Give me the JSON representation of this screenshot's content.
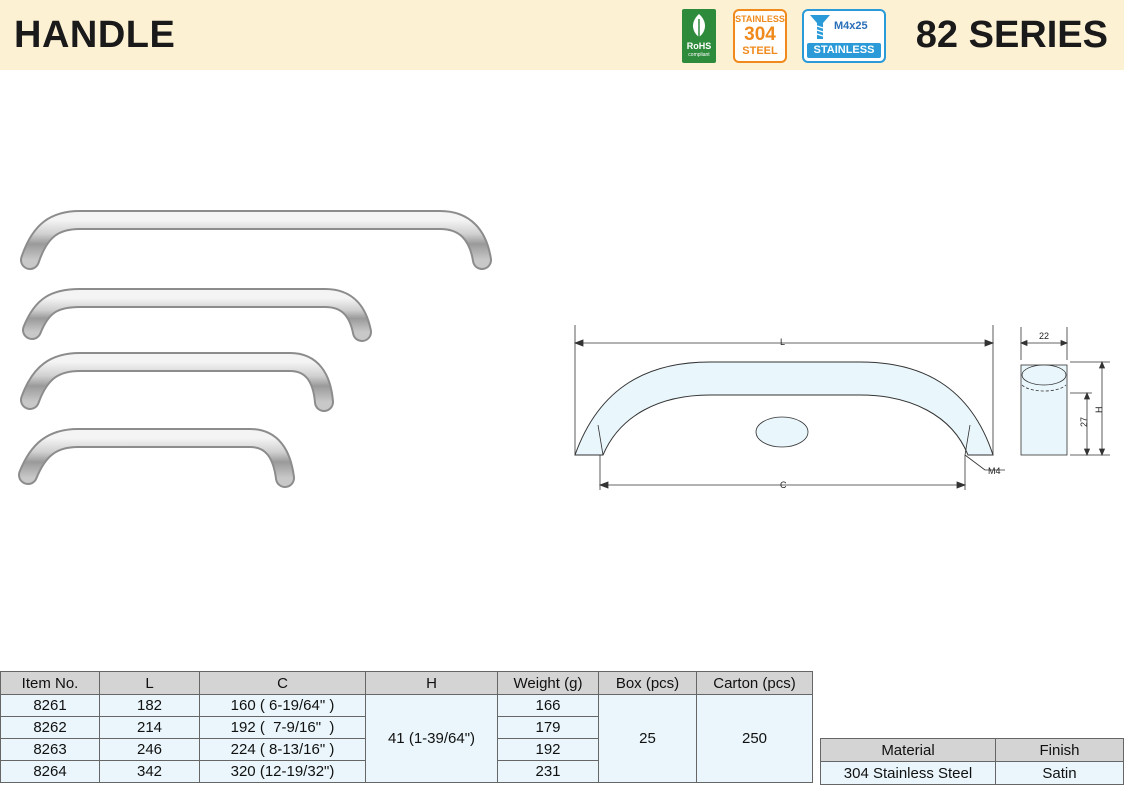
{
  "header": {
    "title": "HANDLE",
    "series": "82 SERIES",
    "rohs": {
      "label": "RoHS",
      "sub": "compliant"
    },
    "stainless304": {
      "top": "STAINLESS",
      "middle": "304",
      "bottom": "STEEL"
    },
    "screw": {
      "size": "M4x25",
      "label": "STAINLESS"
    }
  },
  "drawing": {
    "label_L": "L",
    "label_C": "C",
    "label_M4": "M4",
    "label_22": "22",
    "label_27": "27",
    "label_H": "H"
  },
  "spec_table": {
    "headers": [
      "Item No.",
      "L",
      "C",
      "H",
      "Weight (g)",
      "Box (pcs)",
      "Carton (pcs)"
    ],
    "rows": [
      {
        "item": "8261",
        "L": "182",
        "C": "160 ( 6-19/64\" )",
        "weight": "166"
      },
      {
        "item": "8262",
        "L": "214",
        "C": "192 (  7-9/16\"  )",
        "weight": "179"
      },
      {
        "item": "8263",
        "L": "246",
        "C": "224 ( 8-13/16\" )",
        "weight": "192"
      },
      {
        "item": "8264",
        "L": "342",
        "C": "320 (12-19/32\")",
        "weight": "231"
      }
    ],
    "H": "41 (1-39/64\")",
    "box": "25",
    "carton": "250"
  },
  "material_table": {
    "headers": [
      "Material",
      "Finish"
    ],
    "material": "304 Stainless Steel",
    "finish": "Satin"
  }
}
